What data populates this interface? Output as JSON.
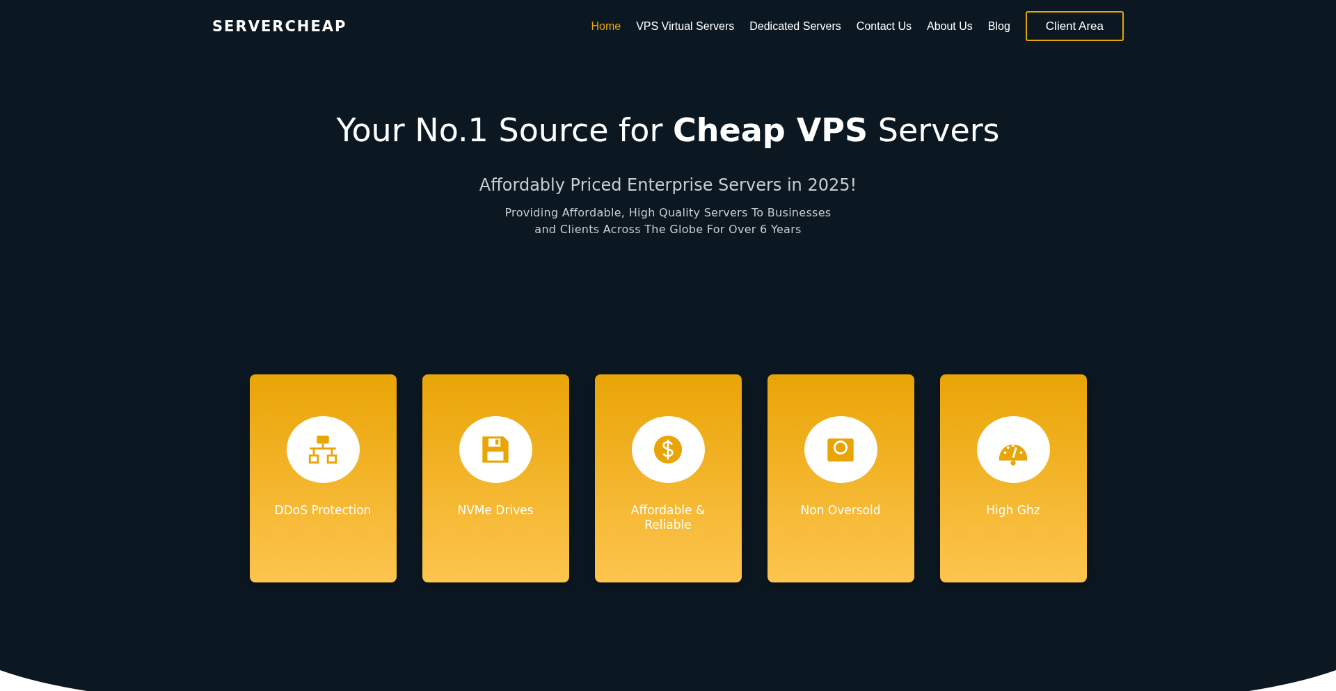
{
  "header": {
    "logo": "SERVERCHEAP",
    "nav": [
      {
        "label": "Home",
        "selected": true
      },
      {
        "label": "VPS Virtual Servers",
        "selected": false
      },
      {
        "label": "Dedicated Servers",
        "selected": false
      },
      {
        "label": "Contact Us",
        "selected": false
      },
      {
        "label": "About Us",
        "selected": false
      },
      {
        "label": "Blog",
        "selected": false
      }
    ],
    "button": "Client Area"
  },
  "hero": {
    "headline": "Your No.1 Source for **Cheap VPS** Servers",
    "subtitle": "Affordably Priced Enterprise Servers in 2025!",
    "description": "Providing Affordable, High Quality Servers To Businesses and Clients Across The Globe For Over 6 Years"
  },
  "features": [
    {
      "kind": "network",
      "label": "DDoS Protection"
    },
    {
      "kind": "floppy",
      "label": "NVMe Drives"
    },
    {
      "kind": "dollar",
      "label": "Affordable & Reliable"
    },
    {
      "kind": "scale",
      "label": "Non Oversold"
    },
    {
      "kind": "gauge",
      "label": "High Ghz"
    }
  ]
}
